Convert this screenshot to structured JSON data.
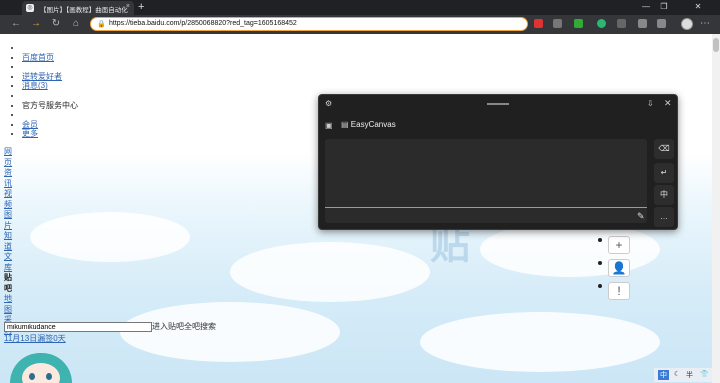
{
  "browser": {
    "tab_title": "【图片】【画教程】曲面自动化",
    "close_tab_glyph": "×",
    "new_tab_glyph": "+",
    "url": "https://tieba.baidu.com/p/2850068820?red_tag=1605168452"
  },
  "top_nav": {
    "items": [
      {
        "label": "",
        "link": false
      },
      {
        "label": "百度首页",
        "link": true
      },
      {
        "label": "",
        "link": false
      },
      {
        "label": "逆转爱好者",
        "link": true
      },
      {
        "label": "消息(3)",
        "link": true
      },
      {
        "label": "",
        "link": false
      },
      {
        "label": "官方号服务中心",
        "link": false
      },
      {
        "label": "",
        "link": false
      },
      {
        "label": "会员",
        "link": true
      },
      {
        "label": "更多",
        "link": true
      }
    ]
  },
  "side_nav": {
    "chars": [
      "网",
      "页",
      "资",
      "讯",
      "视",
      "频",
      "图",
      "片",
      "知",
      "道",
      "文",
      "库",
      "贴",
      "吧",
      "地",
      "图",
      "采",
      "购"
    ],
    "bold_index": [
      12,
      13
    ]
  },
  "easy_canvas": {
    "title": "EasyCanvas",
    "buttons": [
      "⌫",
      "↵",
      "中",
      "…"
    ]
  },
  "search": {
    "value": "mikumikudance",
    "submit_label": "进入贴吧",
    "all_label": "全吧搜索"
  },
  "date_bar": "11月13日漏签0天",
  "ime": {
    "lang": "中",
    "status": "半"
  }
}
